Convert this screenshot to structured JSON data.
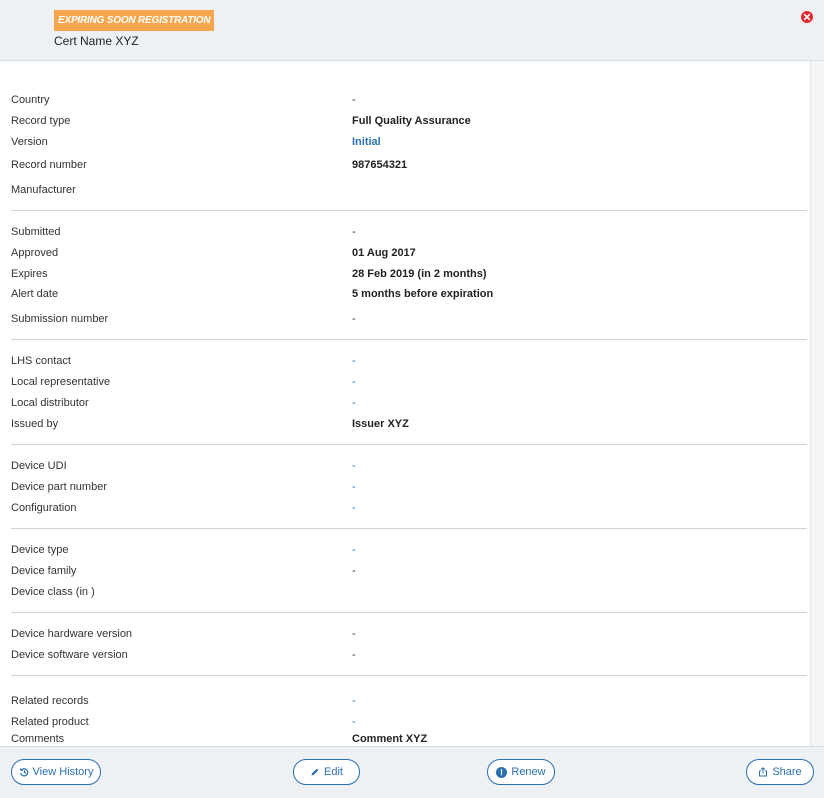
{
  "header": {
    "badge": "EXPIRING SOON REGISTRATION",
    "cert_name": "Cert Name XYZ"
  },
  "sections": {
    "s1": [
      {
        "label": "Country",
        "value": "-"
      },
      {
        "label": "Record type",
        "value": "Full Quality Assurance"
      },
      {
        "label": "Version",
        "value": "Initial"
      },
      {
        "label": "Record number",
        "value": "987654321"
      },
      {
        "label": "Manufacturer",
        "value": ""
      }
    ],
    "s2": [
      {
        "label": "Submitted",
        "value": "-"
      },
      {
        "label": "Approved",
        "value": "01 Aug 2017"
      },
      {
        "label": "Expires",
        "value": "28 Feb 2019 (in 2 months)"
      },
      {
        "label": "Alert date",
        "value": "5 months before expiration"
      },
      {
        "label": "Submission number",
        "value": "-"
      }
    ],
    "s3": [
      {
        "label": "LHS contact",
        "value": "-"
      },
      {
        "label": "Local representative",
        "value": "-"
      },
      {
        "label": "Local distributor",
        "value": "-"
      },
      {
        "label": "Issued by",
        "value": "Issuer XYZ"
      }
    ],
    "s4": [
      {
        "label": "Device UDI",
        "value": "-"
      },
      {
        "label": "Device part number",
        "value": "-"
      },
      {
        "label": "Configuration",
        "value": "-"
      }
    ],
    "s5": [
      {
        "label": "Device type",
        "value": "-"
      },
      {
        "label": "Device family",
        "value": "-"
      },
      {
        "label": "Device class (in )",
        "value": ""
      }
    ],
    "s6": [
      {
        "label": "Device hardware version",
        "value": "-"
      },
      {
        "label": "Device software version",
        "value": "-"
      }
    ],
    "s7": [
      {
        "label": "Related records",
        "value": "-"
      },
      {
        "label": "Related product",
        "value": "-"
      },
      {
        "label": "Comments",
        "value": "Comment XYZ"
      }
    ]
  },
  "footer": {
    "view_history": "View History",
    "edit": "Edit",
    "renew": "Renew",
    "share": "Share"
  },
  "colors": {
    "accent": "#2a6fb0",
    "badge": "#f6a64c",
    "close": "#e02828"
  },
  "icons": {
    "close": "close-icon",
    "history": "history-icon",
    "edit": "pencil-icon",
    "renew": "renew-icon",
    "share": "share-icon"
  }
}
